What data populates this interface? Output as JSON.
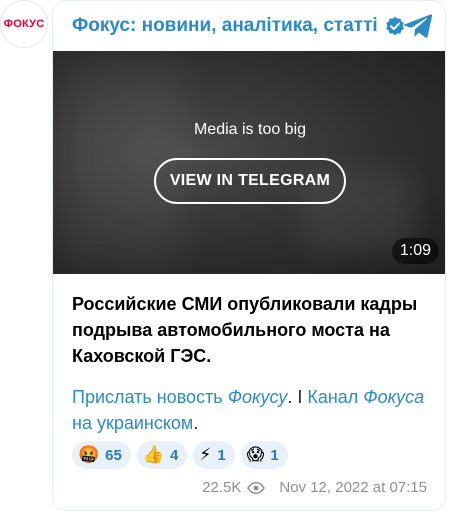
{
  "avatar": {
    "text": "ФОКУС"
  },
  "header": {
    "channel_name": "Фокус: новини, аналітика, статті"
  },
  "media": {
    "notice": "Media is too big",
    "view_button": "VIEW IN TELEGRAM",
    "duration": "1:09"
  },
  "post": {
    "text": "Российские СМИ опубликовали кадры подрыва автомобильного моста на Каховской ГЭС.",
    "links": {
      "link1_part1": "Прислать новость ",
      "link1_italic": "Фокусу",
      "separator1": ". I ",
      "link2_part1": "Канал ",
      "link2_italic": "Фокуса",
      "link2_part2": " на украинском",
      "end": "."
    }
  },
  "reactions": [
    {
      "emoji": "🤬",
      "icon": "angry-face-icon",
      "count": "65"
    },
    {
      "emoji": "👍",
      "icon": "thumbs-up-icon",
      "count": "4"
    },
    {
      "emoji": "⚡",
      "icon": "lightning-icon",
      "count": "1"
    },
    {
      "emoji": "😱",
      "icon": "scream-face-icon",
      "count": "1"
    }
  ],
  "footer": {
    "views": "22.5K",
    "timestamp": "Nov 12, 2022 at 07:15"
  },
  "colors": {
    "accent": "#2a8bc7",
    "brand": "#e4003a"
  }
}
